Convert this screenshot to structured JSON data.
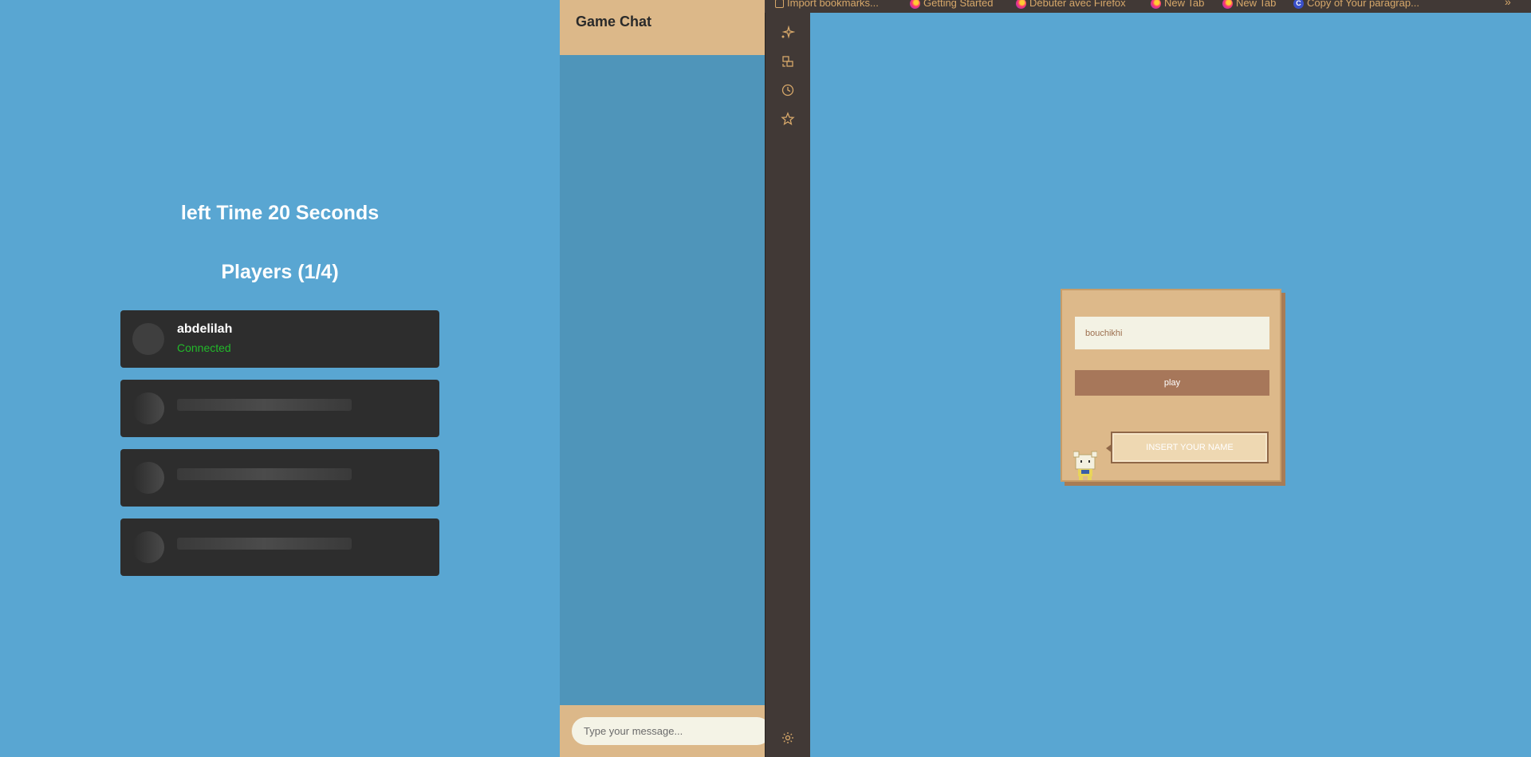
{
  "lobby": {
    "timer_text": "left Time 20 Seconds",
    "players_title": "Players (1/4)",
    "players": [
      {
        "name": "abdelilah",
        "status": "Connected",
        "status_color": "#22b92a"
      }
    ],
    "empty_slots": 3
  },
  "chat": {
    "title": "Game Chat",
    "input_placeholder": "Type your message..."
  },
  "bookmarks": [
    {
      "label": "Import bookmarks...",
      "icon": "import-icon"
    },
    {
      "label": "Getting Started",
      "icon": "firefox-icon"
    },
    {
      "label": "Débuter avec Firefox",
      "icon": "firefox-icon"
    },
    {
      "label": "New Tab",
      "icon": "firefox-icon"
    },
    {
      "label": "New Tab",
      "icon": "firefox-icon"
    },
    {
      "label": "Copy of Your paragrap...",
      "icon": "c-icon"
    }
  ],
  "sidebar": {
    "icons": [
      "sparkle-icon",
      "sync-icon",
      "history-icon",
      "star-icon",
      "gear-icon"
    ]
  },
  "game": {
    "name_input_value": "bouchikhi",
    "play_label": "play",
    "bubble_text": "INSERT YOUR NAME"
  },
  "colors": {
    "background": "#59a6d2",
    "panel": "#ddb98a",
    "play_button": "#a7775a",
    "card": "#2d2d2d",
    "sidebar": "#413936"
  }
}
